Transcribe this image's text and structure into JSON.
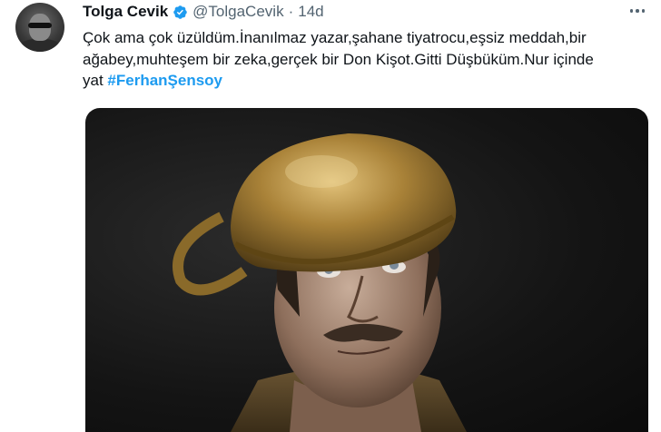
{
  "tweet": {
    "author_name": "Tolga Cevik",
    "handle": "@TolgaCevik",
    "separator": "·",
    "time": "14d",
    "text_lines": [
      "Çok ama çok üzüldüm.İnanılmaz yazar,şahane tiyatrocu,eşsiz meddah,bir",
      "ağabey,muhteşem bir zeka,gerçek bir Don Kişot.Gitti Düşbüküm.Nur içinde",
      "yat "
    ],
    "hashtag": "#FerhanŞensoy"
  },
  "icons": {
    "verified": "verified-badge-icon",
    "more": "more-options-icon",
    "verified_color": "#1d9bf0"
  },
  "colors": {
    "text": "#0f1419",
    "secondary": "#536471",
    "link": "#1d9bf0"
  }
}
